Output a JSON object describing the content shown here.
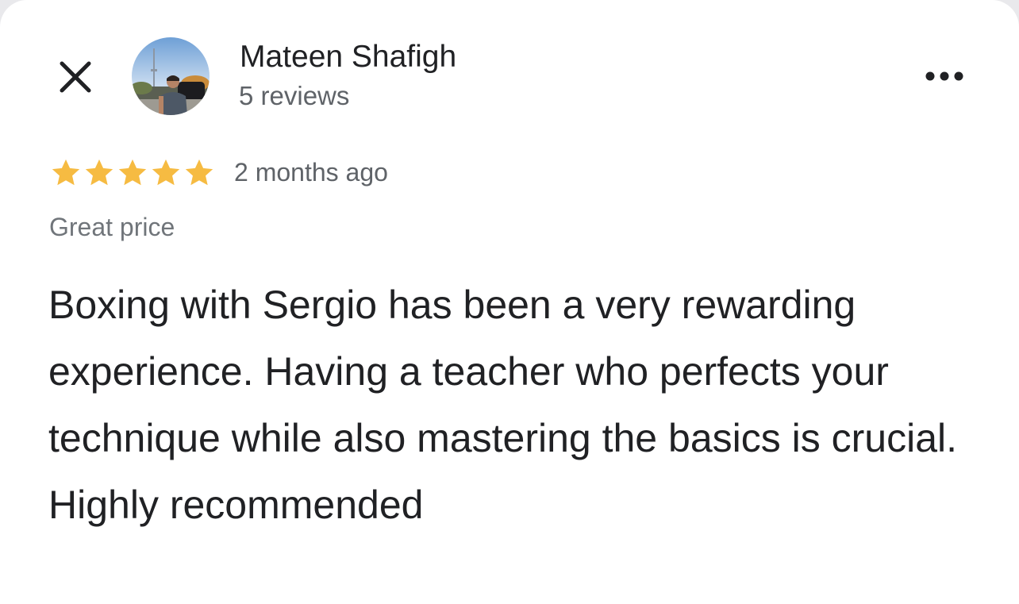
{
  "reviewer": {
    "name": "Mateen Shafigh",
    "review_count": "5 reviews",
    "avatar_icon": "profile-photo-avatar"
  },
  "toolbar": {
    "close_icon": "close-icon",
    "more_icon": "more-horizontal-icon"
  },
  "review": {
    "rating": 5,
    "max_rating": 5,
    "star_color": "#f6bb42",
    "date": "2 months ago",
    "tag": "Great price",
    "text": "Boxing with Sergio has been a very rewarding experience. Having a teacher who perfects your technique while also mastering the basics is crucial. Highly recommended"
  }
}
